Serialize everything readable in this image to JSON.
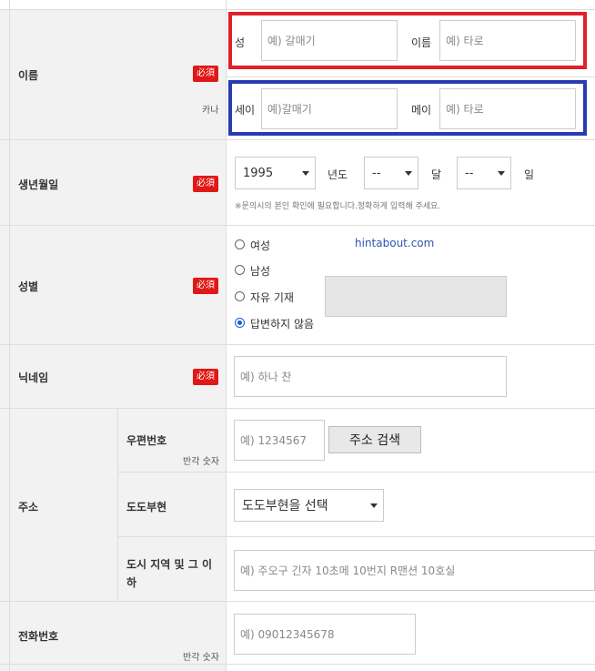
{
  "name_row": {
    "label": "이름",
    "kana_sub": "카나",
    "sei_label": "성",
    "sei_placeholder": "예) 갈매기",
    "mei_label": "이름",
    "mei_placeholder": "예) 타로",
    "kana_sei_label": "세이",
    "kana_sei_placeholder": "예)갈매기",
    "kana_mei_label": "메이",
    "kana_mei_placeholder": "예) 타로",
    "highlight_colors": {
      "red": "#e0202a",
      "blue": "#2a3ab0"
    }
  },
  "required_badge": "必須",
  "birth_row": {
    "label": "생년월일",
    "year_value": "1995",
    "year_unit": "년도",
    "month_value": "--",
    "month_unit": "달",
    "day_value": "--",
    "day_unit": "일",
    "note": "※문의시의 본인 확인에 필요합니다.정확하게 입력해 주세요."
  },
  "gender_row": {
    "label": "성별",
    "options": [
      "여성",
      "남성",
      "자유 기재",
      "답변하지 않음"
    ],
    "selected": "답변하지 않음",
    "watermark": "hintabout.com"
  },
  "nickname_row": {
    "label": "닉네임",
    "placeholder": "예) 하나 찬"
  },
  "address_section": {
    "label": "주소",
    "postal_label": "우편번호",
    "postal_sub": "반각 숫자",
    "postal_placeholder": "예) 1234567",
    "search_button": "주소 검색",
    "prefecture_label": "도도부현",
    "prefecture_value": "도도부현을 선택",
    "city_label": "도시 지역 및 그 이하",
    "city_placeholder": "예) 주오구 긴자 10초메 10번지 R맨션 10호실"
  },
  "phone_row": {
    "label": "전화번호",
    "sub": "반각 숫자",
    "placeholder": "예) 09012345678"
  }
}
